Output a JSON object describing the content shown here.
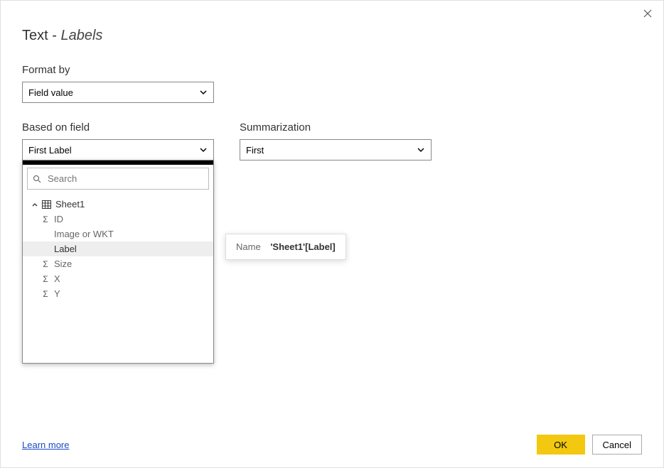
{
  "dialog": {
    "title_prefix": "Text - ",
    "title_labels": "Labels"
  },
  "format_by": {
    "label": "Format by",
    "value": "Field value"
  },
  "based_on_field": {
    "label": "Based on field",
    "value": "First Label"
  },
  "summarization": {
    "label": "Summarization",
    "value": "First"
  },
  "search": {
    "placeholder": "Search"
  },
  "tree": {
    "table_name": "Sheet1",
    "fields": {
      "id": "ID",
      "image_or_wkt": "Image or WKT",
      "label": "Label",
      "size": "Size",
      "x": "X",
      "y": "Y"
    }
  },
  "tooltip": {
    "label": "Name",
    "value": "'Sheet1'[Label]"
  },
  "footer": {
    "learn_more": "Learn more",
    "ok": "OK",
    "cancel": "Cancel"
  }
}
